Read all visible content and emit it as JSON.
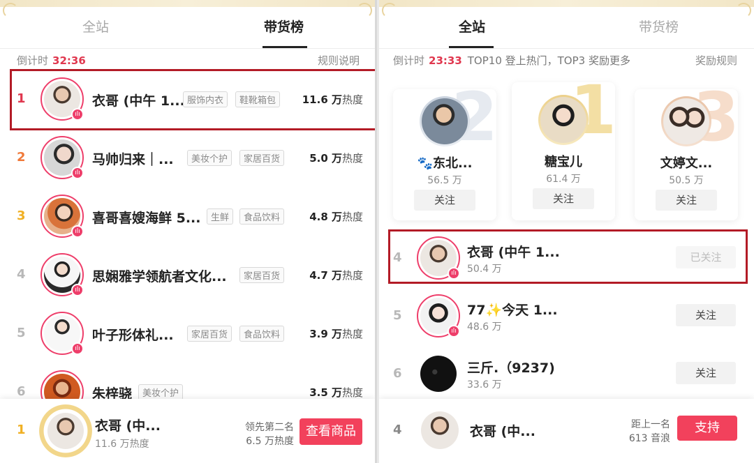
{
  "left": {
    "tabs": [
      {
        "label": "全站"
      },
      {
        "label": "带货榜"
      }
    ],
    "countdown_label": "倒计时",
    "countdown_time": "32:36",
    "rules_link": "规则说明",
    "rows": [
      {
        "rank": "1",
        "name": "衣哥 (中午 1...",
        "tags": [
          "服饰内衣",
          "鞋靴箱包"
        ],
        "heat_value": "11.6 万",
        "heat_unit": "热度"
      },
      {
        "rank": "2",
        "name": "马帅归来｜...",
        "tags": [
          "美妆个护",
          "家居百货"
        ],
        "heat_value": "5.0 万",
        "heat_unit": "热度"
      },
      {
        "rank": "3",
        "name": "喜哥喜嫂海鲜 5...",
        "tags": [
          "生鲜",
          "食品饮料"
        ],
        "heat_value": "4.8 万",
        "heat_unit": "热度"
      },
      {
        "rank": "4",
        "name": "思娴雅学领航者文化...",
        "tags": [
          "家居百货"
        ],
        "heat_value": "4.7 万",
        "heat_unit": "热度"
      },
      {
        "rank": "5",
        "name": "叶子形体礼...",
        "tags": [
          "家居百货",
          "食品饮料"
        ],
        "heat_value": "3.9 万",
        "heat_unit": "热度"
      },
      {
        "rank": "6",
        "name": "朱梓骁",
        "tags": [
          "美妆个护"
        ],
        "heat_value": "3.5 万",
        "heat_unit": "热度"
      }
    ],
    "bottom": {
      "rank": "1",
      "name": "衣哥 (中...",
      "heat": "11.6 万热度",
      "lead_label": "领先第二名",
      "lead_value": "6.5 万热度",
      "button": "查看商品"
    }
  },
  "right": {
    "tabs": [
      {
        "label": "全站"
      },
      {
        "label": "带货榜"
      }
    ],
    "countdown_label": "倒计时",
    "countdown_time": "23:33",
    "countdown_tip": "TOP10 登上热门，TOP3 奖励更多",
    "rules_link": "奖励规则",
    "podium": [
      {
        "place": "2",
        "name": "🐾东北...",
        "score": "56.5 万",
        "follow": "关注"
      },
      {
        "place": "1",
        "name": "糖宝儿",
        "score": "61.4 万",
        "follow": "关注"
      },
      {
        "place": "3",
        "name": "文婷文...",
        "score": "50.5 万",
        "follow": "关注"
      }
    ],
    "rows": [
      {
        "rank": "4",
        "name": "衣哥 (中午 1...",
        "score": "50.4 万",
        "follow": "已关注"
      },
      {
        "rank": "5",
        "name": "77✨今天 1...",
        "score": "48.6 万",
        "follow": "关注"
      },
      {
        "rank": "6",
        "name": "三斤.（9237)",
        "score": "33.6 万",
        "follow": "关注"
      }
    ],
    "bottom": {
      "rank": "4",
      "name": "衣哥 (中...",
      "gap_label": "距上一名",
      "gap_value": "613 音浪",
      "button": "支持"
    }
  },
  "colors": {
    "accent_red": "#f2415c",
    "highlight_border": "#b31b26",
    "live_pink": "#ee3e6a",
    "gold": "#f0b024"
  },
  "icons": {
    "live_badge": "live-icon",
    "gold_frame": "gold-frame-icon"
  }
}
